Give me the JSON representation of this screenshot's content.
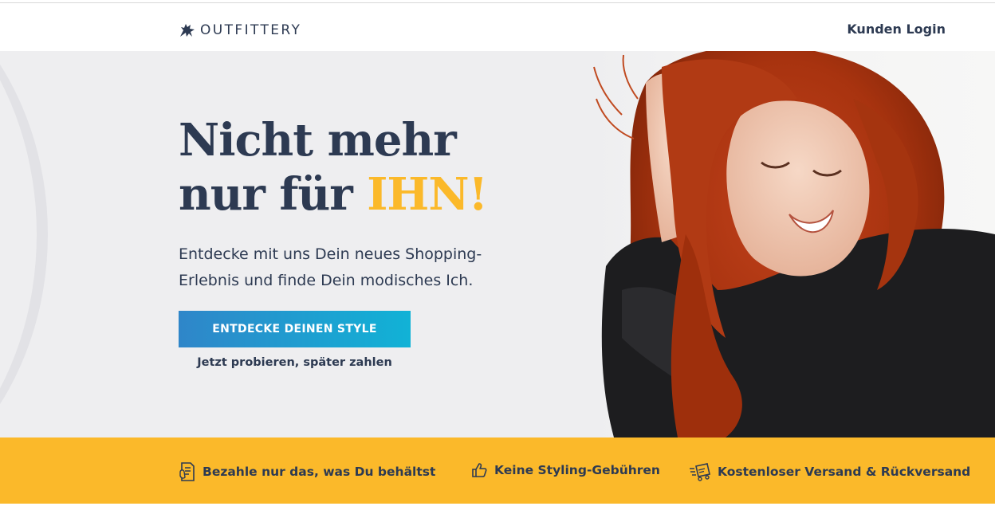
{
  "header": {
    "brand": "OUTFITTERY",
    "login_label": "Kunden Login"
  },
  "hero": {
    "headline_line1": "Nicht mehr",
    "headline_line2_prefix": "nur für ",
    "headline_accent": "IHN!",
    "subline": "Entdecke mit uns Dein neues Shopping-Erlebnis und finde Dein modisches Ich.",
    "cta_label": "ENTDECKE DEINEN STYLE",
    "cta_note": "Jetzt probieren, später zahlen"
  },
  "usp": [
    {
      "label": "Bezahle nur das, was Du behältst",
      "icon": "receipt-icon"
    },
    {
      "label": "Keine Styling-Gebühren",
      "icon": "thumbs-up-icon"
    },
    {
      "label": "Kostenloser Versand & Rückversand",
      "icon": "shipping-box-icon"
    }
  ],
  "colors": {
    "navy": "#2d3a52",
    "accent_yellow": "#fbb92a",
    "cta_start": "#2f86c9",
    "cta_end": "#11b2d6",
    "hero_bg": "#eeeef0"
  }
}
